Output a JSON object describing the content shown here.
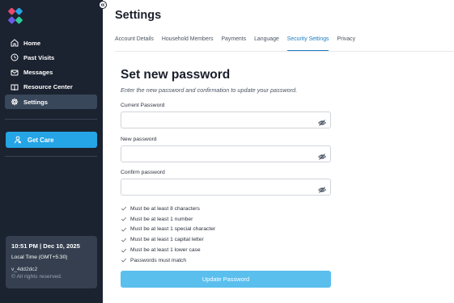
{
  "colors": {
    "sidebar_bg": "#1b2230",
    "active_nav_bg": "#39475a",
    "primary": "#25a4e6",
    "button_disabled": "#5bbfee",
    "tab_active": "#1c7cc2"
  },
  "sidebar": {
    "logo_icon": "four-diamonds-logo",
    "items": [
      {
        "label": "Home",
        "icon": "home-icon"
      },
      {
        "label": "Past Visits",
        "icon": "clock-icon"
      },
      {
        "label": "Messages",
        "icon": "mail-icon"
      },
      {
        "label": "Resource Center",
        "icon": "book-icon"
      },
      {
        "label": "Settings",
        "icon": "gear-icon",
        "active": true
      }
    ],
    "get_care_label": "Get Care",
    "info": {
      "time": "10:51 PM | Dec 10, 2025",
      "timezone": "Local Time (GMT+5:30)",
      "version": "v_4dd2dc2",
      "rights": "© All rights reserved."
    }
  },
  "header": {
    "title": "Settings"
  },
  "tabs": [
    {
      "label": "Account Details"
    },
    {
      "label": "Household Members"
    },
    {
      "label": "Payments"
    },
    {
      "label": "Language"
    },
    {
      "label": "Security Settings",
      "active": true
    },
    {
      "label": "Privacy"
    }
  ],
  "form": {
    "title": "Set new password",
    "subtitle": "Enter the new password and confirmation to update your password.",
    "current_label": "Current Password",
    "current_value": "",
    "new_label": "New password",
    "new_value": "",
    "confirm_label": "Confirm password",
    "confirm_value": "",
    "rules": [
      "Must be at least 8 characters",
      "Must be at least 1 number",
      "Must be at least 1 special character",
      "Must be at least 1 capital letter",
      "Must be at least 1 lower case",
      "Passwords must match"
    ],
    "submit_label": "Update Password"
  }
}
